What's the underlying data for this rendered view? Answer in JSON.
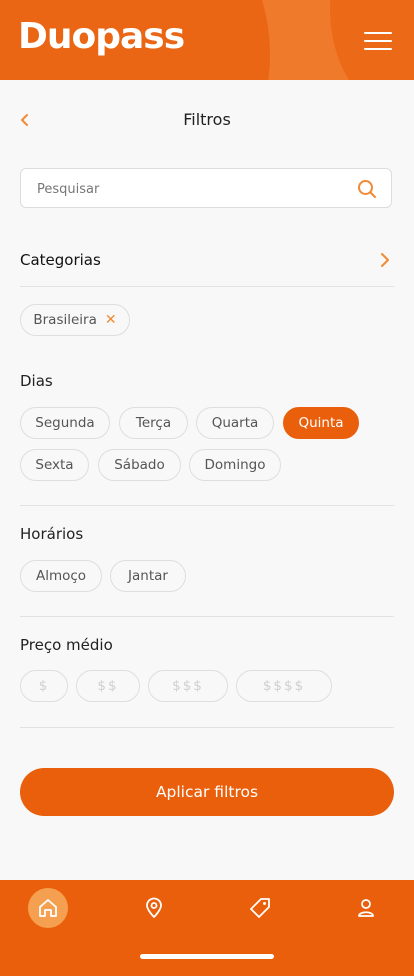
{
  "app": {
    "logo_text": "Duopass"
  },
  "header": {
    "title": "Filtros"
  },
  "search": {
    "placeholder": "Pesquisar",
    "value": ""
  },
  "categories": {
    "label": "Categorias",
    "selected": [
      {
        "label": "Brasileira"
      }
    ]
  },
  "days": {
    "title": "Dias",
    "options": [
      {
        "label": "Segunda",
        "selected": false
      },
      {
        "label": "Terça",
        "selected": false
      },
      {
        "label": "Quarta",
        "selected": false
      },
      {
        "label": "Quinta",
        "selected": true
      },
      {
        "label": "Sexta",
        "selected": false
      },
      {
        "label": "Sábado",
        "selected": false
      },
      {
        "label": "Domingo",
        "selected": false
      }
    ]
  },
  "times": {
    "title": "Horários",
    "options": [
      {
        "label": "Almoço"
      },
      {
        "label": "Jantar"
      }
    ]
  },
  "price": {
    "title": "Preço médio",
    "options": [
      {
        "label": "$"
      },
      {
        "label": "$$"
      },
      {
        "label": "$$$"
      },
      {
        "label": "$$$$"
      }
    ]
  },
  "apply_button": {
    "label": "Aplicar filtros"
  },
  "nav": {
    "items": [
      {
        "icon": "home-icon",
        "active": true
      },
      {
        "icon": "location-pin-icon"
      },
      {
        "icon": "tag-icon"
      },
      {
        "icon": "user-icon"
      }
    ]
  },
  "colors": {
    "accent": "#ea5f0b",
    "accent_light": "#f08a34"
  }
}
